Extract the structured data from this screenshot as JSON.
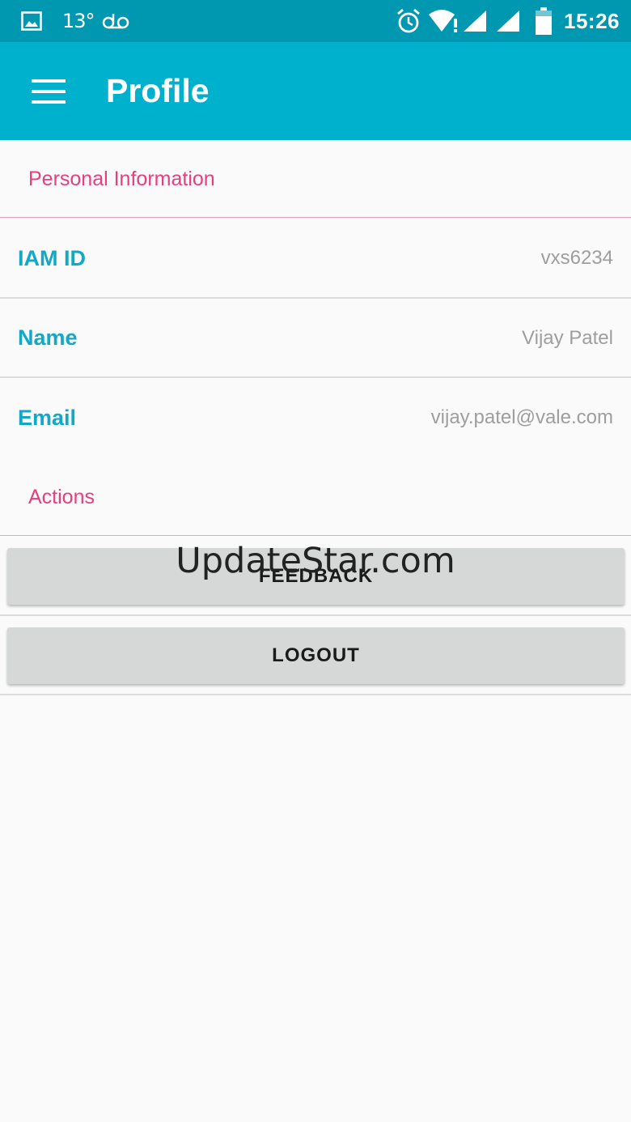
{
  "status_bar": {
    "temperature": "13°",
    "time": "15:26",
    "icons": [
      "image-icon",
      "voicemail-icon",
      "alarm-icon",
      "wifi-alert-icon",
      "signal-icon",
      "signal-icon",
      "battery-icon"
    ]
  },
  "app_bar": {
    "title": "Profile",
    "menu_icon": "hamburger-menu-icon"
  },
  "sections": {
    "personal_info": "Personal Information",
    "actions": "Actions"
  },
  "fields": [
    {
      "label": "IAM ID",
      "value": "vxs6234"
    },
    {
      "label": "Name",
      "value": "Vijay Patel"
    },
    {
      "label": "Email",
      "value": "vijay.patel@vale.com"
    }
  ],
  "buttons": {
    "feedback": "FEEDBACK",
    "logout": "LOGOUT"
  },
  "watermark": "UpdateStar.com",
  "colors": {
    "status_bar": "#0097b0",
    "app_bar": "#00b1cd",
    "section_header": "#e83e7e",
    "field_label": "#13a8c6",
    "field_value": "#9e9e9e",
    "button_bg": "#d6d7d7"
  }
}
